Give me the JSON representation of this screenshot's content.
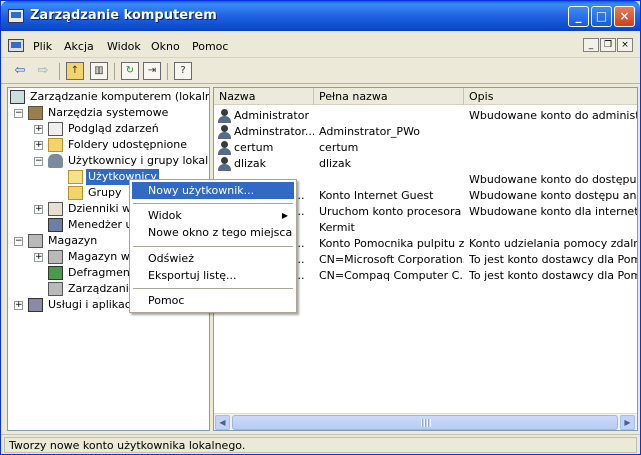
{
  "window": {
    "title": "Zarządzanie komputerem",
    "controls": {
      "minimize": "_",
      "maximize": "□",
      "close": "×"
    }
  },
  "menubar": {
    "items": [
      "Plik",
      "Akcja",
      "Widok",
      "Okno",
      "Pomoc"
    ],
    "mdi": {
      "minimize": "_",
      "restore": "❐",
      "close": "×"
    }
  },
  "toolbar": {
    "buttons": [
      "back-icon",
      "forward-icon",
      "up-folder-icon",
      "show-tree-icon",
      "refresh-icon",
      "export-list-icon",
      "help-icon"
    ]
  },
  "tree": {
    "items": [
      {
        "label": "Zarządzanie komputerem (lokalne)",
        "icon": "computer-management-icon"
      },
      {
        "label": "Narzędzia systemowe",
        "icon": "system-tools-icon",
        "expander": "−"
      },
      {
        "label": "Podgląd zdarzeń",
        "icon": "event-viewer-icon",
        "expander": "+"
      },
      {
        "label": "Foldery udostępnione",
        "icon": "shared-folders-icon",
        "expander": "+"
      },
      {
        "label": "Użytkownicy i grupy lokalne",
        "icon": "local-users-icon",
        "expander": "−"
      },
      {
        "label": "Użytkownicy",
        "icon": "folder-open-icon",
        "selected": true
      },
      {
        "label": "Grupy",
        "icon": "folder-icon"
      },
      {
        "label": "Dzienniki wyd",
        "icon": "performance-logs-icon",
        "expander": "+"
      },
      {
        "label": "Menedżer ur",
        "icon": "device-manager-icon"
      },
      {
        "label": "Magazyn",
        "icon": "storage-icon",
        "expander": "−"
      },
      {
        "label": "Magazyn wy",
        "icon": "removable-storage-icon",
        "expander": "+"
      },
      {
        "label": "Defragment",
        "icon": "defrag-icon"
      },
      {
        "label": "Zarządzanie",
        "icon": "disk-management-icon"
      },
      {
        "label": "Usługi i aplikacje",
        "icon": "services-icon",
        "expander": "+"
      }
    ]
  },
  "list": {
    "columns": [
      "Nazwa",
      "Pełna nazwa",
      "Opis"
    ],
    "rows": [
      {
        "name": "Administrator",
        "full_name": "",
        "description": "Wbudowane konto do administrowa"
      },
      {
        "name": "Adminstrator...",
        "full_name": "Adminstrator_PWo",
        "description": ""
      },
      {
        "name": "certum",
        "full_name": "certum",
        "description": ""
      },
      {
        "name": "dlizak",
        "full_name": "dlizak",
        "description": ""
      },
      {
        "name": "",
        "full_name": "",
        "description": "Wbudowane konto do dostępu do k"
      },
      {
        "name": "...",
        "full_name": "Konto Internet Guest",
        "description": "Wbudowane konto dostępu anonim"
      },
      {
        "name": "...",
        "full_name": "Uruchom konto procesora ...",
        "description": "Wbudowane konto dla internetowy"
      },
      {
        "name": "",
        "full_name": "Kermit",
        "description": ""
      },
      {
        "name": "...",
        "full_name": "Konto Pomocnika pulpitu z...",
        "description": "Konto udzielania pomocy zdalnej"
      },
      {
        "name": "...",
        "full_name": "CN=Microsoft Corporation...",
        "description": "To jest konto dostawcy dla Pomocy"
      },
      {
        "name": "...",
        "full_name": "CN=Compaq Computer C...",
        "description": "To jest konto dostawcy dla Pomocy"
      }
    ],
    "scroll": {
      "left": "◀",
      "right": "▶"
    }
  },
  "context_menu": {
    "items": [
      {
        "label": "Nowy użytkownik...",
        "highlighted": true
      },
      {
        "separator": true
      },
      {
        "label": "Widok",
        "submenu": true,
        "arrow": "▶"
      },
      {
        "label": "Nowe okno z tego miejsca"
      },
      {
        "separator": true
      },
      {
        "label": "Odśwież"
      },
      {
        "label": "Eksportuj listę..."
      },
      {
        "separator": true
      },
      {
        "label": "Pomoc"
      }
    ]
  },
  "statusbar": {
    "text": "Tworzy nowe konto użytkownika lokalnego."
  }
}
